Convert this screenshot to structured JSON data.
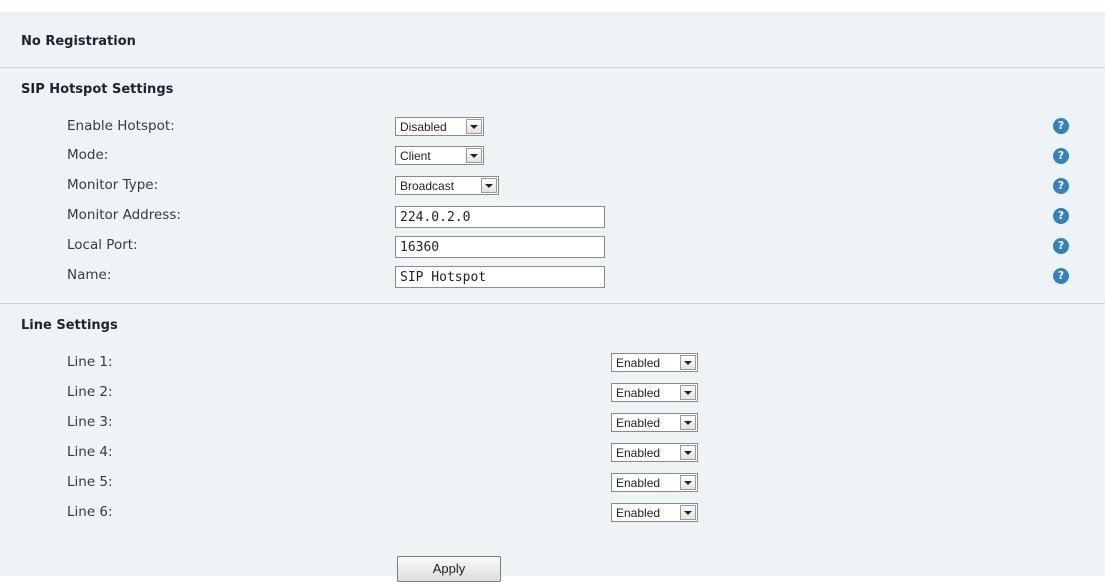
{
  "header": {
    "title": "No Registration"
  },
  "hotspot": {
    "title": "SIP Hotspot Settings",
    "enable_label": "Enable Hotspot:",
    "enable_value": "Disabled",
    "mode_label": "Mode:",
    "mode_value": "Client",
    "monitor_type_label": "Monitor Type:",
    "monitor_type_value": "Broadcast",
    "monitor_address_label": "Monitor Address:",
    "monitor_address_value": "224.0.2.0",
    "local_port_label": "Local Port:",
    "local_port_value": "16360",
    "name_label": "Name:",
    "name_value": "SIP Hotspot",
    "help_glyph": "?"
  },
  "lines": {
    "title": "Line Settings",
    "items": [
      {
        "label": "Line 1:",
        "value": "Enabled"
      },
      {
        "label": "Line 2:",
        "value": "Enabled"
      },
      {
        "label": "Line 3:",
        "value": "Enabled"
      },
      {
        "label": "Line 4:",
        "value": "Enabled"
      },
      {
        "label": "Line 5:",
        "value": "Enabled"
      },
      {
        "label": "Line 6:",
        "value": "Enabled"
      }
    ]
  },
  "actions": {
    "apply_label": "Apply"
  },
  "colors": {
    "panel_bg": "#eef4f6",
    "help_icon": "#2f83c4",
    "rule": "#c9d3d8"
  }
}
